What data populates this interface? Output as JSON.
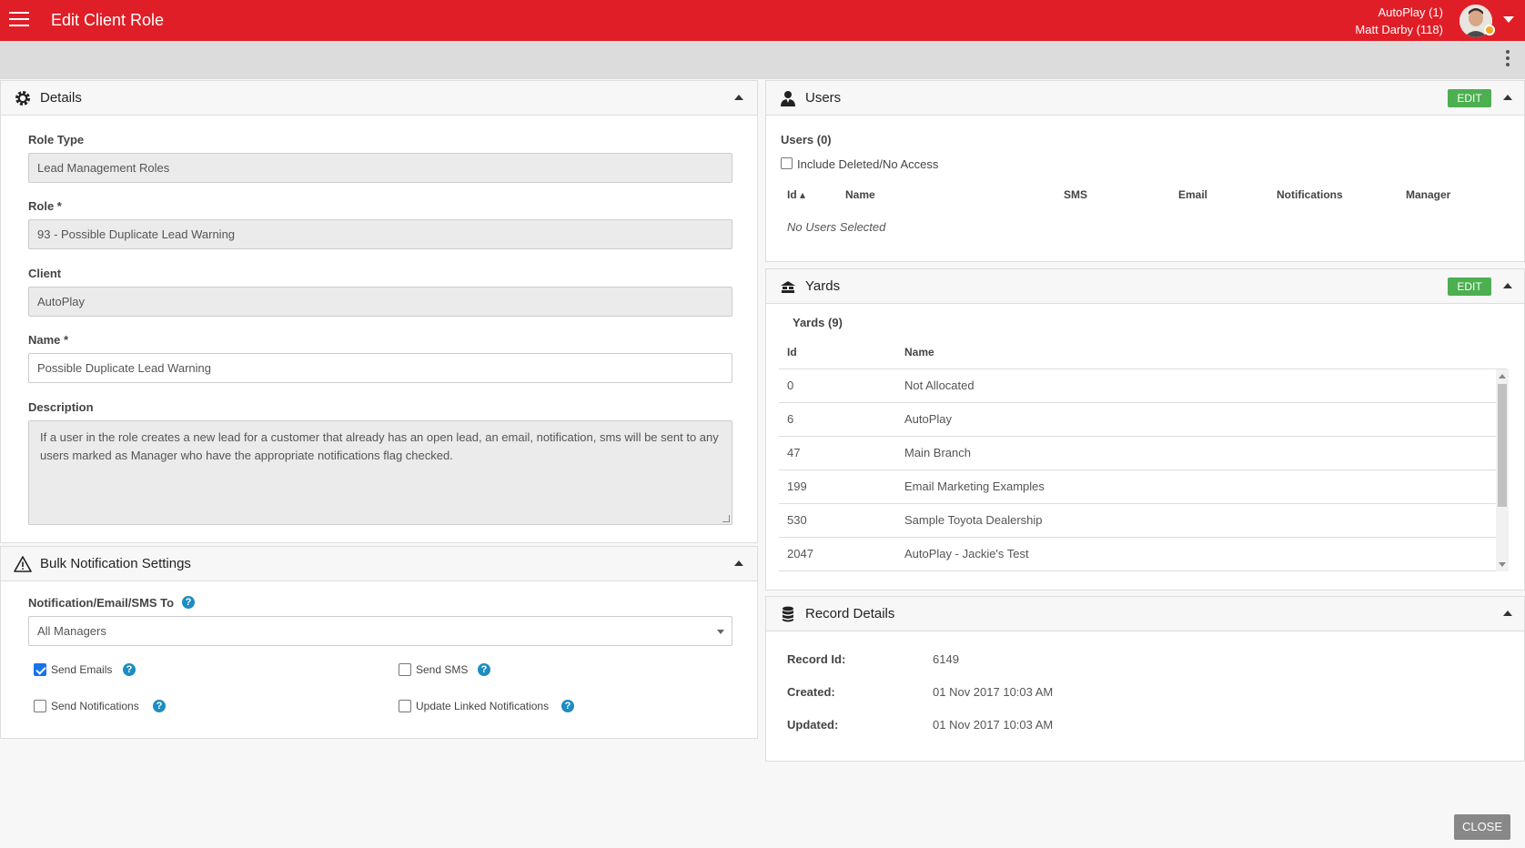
{
  "header": {
    "title": "Edit Client Role",
    "account_line1": "AutoPlay (1)",
    "account_line2": "Matt Darby (118)"
  },
  "details": {
    "title": "Details",
    "role_type_label": "Role Type",
    "role_type_value": "Lead Management Roles",
    "role_label": "Role *",
    "role_value": "93 - Possible Duplicate Lead Warning",
    "client_label": "Client",
    "client_value": "AutoPlay",
    "name_label": "Name *",
    "name_value": "Possible Duplicate Lead Warning",
    "description_label": "Description",
    "description_value": "If a user in the role creates a new lead for a customer that already has an open lead, an email, notification, sms will be sent to any users marked as Manager who have the appropriate notifications flag checked."
  },
  "bulk": {
    "title": "Bulk Notification Settings",
    "to_label": "Notification/Email/SMS To",
    "to_value": "All Managers",
    "send_emails": "Send Emails",
    "send_sms": "Send SMS",
    "send_notifications": "Send Notifications",
    "update_linked": "Update Linked Notifications",
    "help": "?"
  },
  "users": {
    "title": "Users",
    "edit": "EDIT",
    "count": "Users (0)",
    "include_deleted": "Include Deleted/No Access",
    "columns": [
      "Id ▴",
      "Name",
      "SMS",
      "Email",
      "Notifications",
      "Manager"
    ],
    "empty": "No Users Selected"
  },
  "yards": {
    "title": "Yards",
    "edit": "EDIT",
    "count": "Yards (9)",
    "columns": [
      "Id",
      "Name"
    ],
    "rows": [
      {
        "id": "0",
        "name": "Not Allocated"
      },
      {
        "id": "6",
        "name": "AutoPlay"
      },
      {
        "id": "47",
        "name": "Main Branch"
      },
      {
        "id": "199",
        "name": "Email Marketing Examples"
      },
      {
        "id": "530",
        "name": "Sample Toyota Dealership"
      },
      {
        "id": "2047",
        "name": "AutoPlay - Jackie's Test"
      }
    ]
  },
  "record": {
    "title": "Record Details",
    "id_label": "Record Id:",
    "id_value": "6149",
    "created_label": "Created:",
    "created_value": "01 Nov 2017 10:03 AM",
    "updated_label": "Updated:",
    "updated_value": "01 Nov 2017 10:03 AM"
  },
  "footer": {
    "close": "CLOSE"
  },
  "icons": {
    "menu": "hamburger-icon",
    "details": "gear-icon",
    "bulk": "warning-icon",
    "users": "user-icon",
    "yards": "yards-icon",
    "record": "database-icon",
    "more": "kebab-icon"
  },
  "colors": {
    "brand": "#e01e27",
    "edit_button": "#4caf50",
    "help": "#1e8dc1",
    "checkbox": "#1a73e8",
    "close_button": "#888888"
  }
}
